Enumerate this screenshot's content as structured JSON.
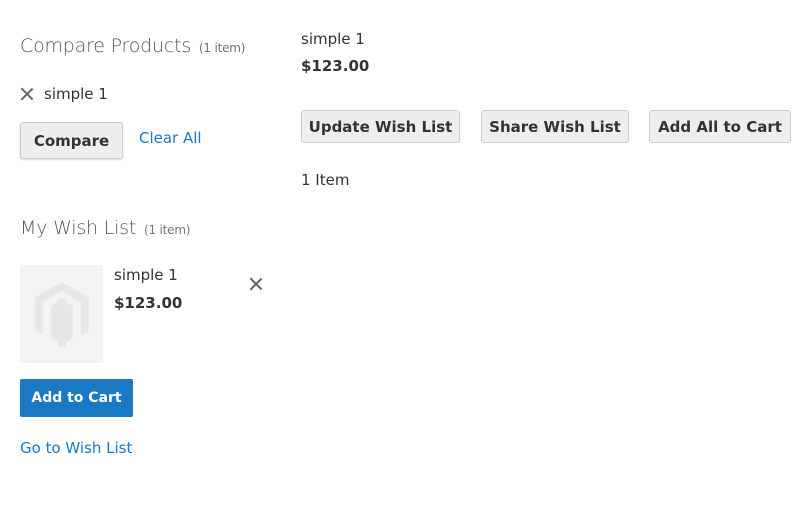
{
  "sidebar": {
    "compare": {
      "title": "Compare Products",
      "count": "(1 item)",
      "items": [
        {
          "name": "simple 1",
          "remove_icon": "close-icon"
        }
      ],
      "compare_label": "Compare",
      "clear_all_label": "Clear All"
    },
    "wishlist": {
      "title": "My Wish List",
      "count": "(1 item)",
      "items": [
        {
          "name": "simple 1",
          "price": "$123.00",
          "thumbnail_icon": "magento-logo-placeholder",
          "remove_icon": "close-icon"
        }
      ],
      "add_to_cart_label": "Add to Cart",
      "go_to_wishlist_label": "Go to Wish List"
    }
  },
  "main": {
    "product": {
      "name": "simple 1",
      "price": "$123.00"
    },
    "actions": {
      "update_label": "Update Wish List",
      "share_label": "Share Wish List",
      "add_all_label": "Add All to Cart"
    },
    "item_count": "1 Item"
  },
  "colors": {
    "link": "#1979c3",
    "primary_button": "#1979c3",
    "secondary_button": "#eeeeee",
    "text": "#333333"
  }
}
